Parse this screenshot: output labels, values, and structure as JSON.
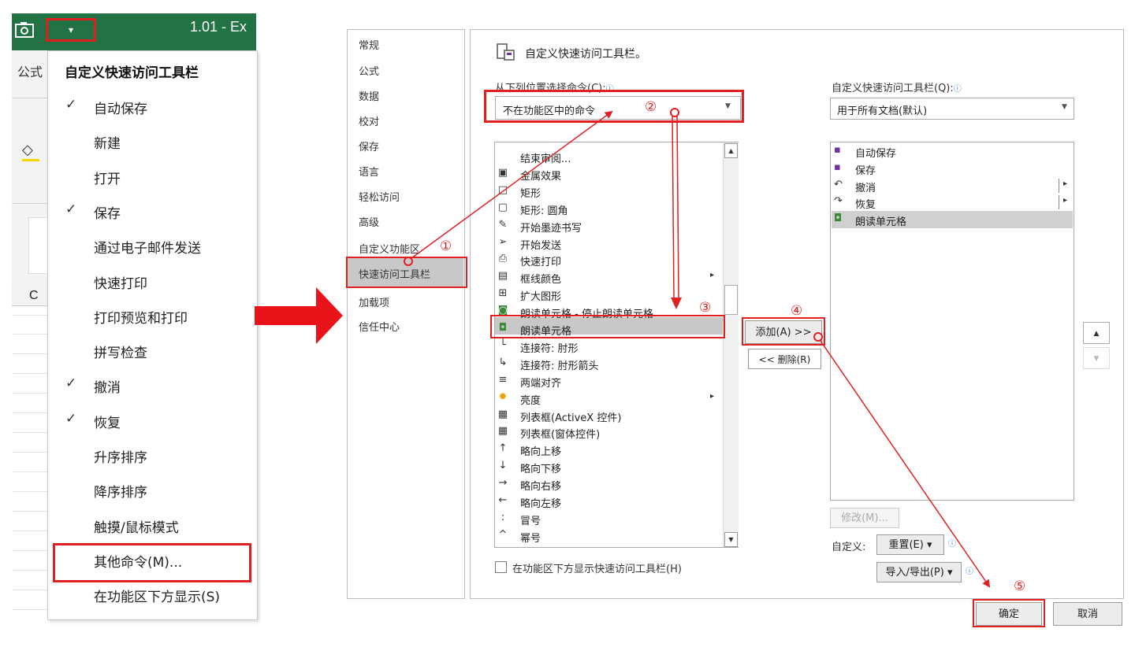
{
  "excel": {
    "file_title": "1.01  -  Ex",
    "qat_dropdown_glyph": "▾",
    "ribbon_tab": "公式",
    "column_header": "C"
  },
  "qat_menu": {
    "title": "自定义快速访问工具栏",
    "check_glyph": "✓",
    "items": [
      {
        "label": "自动保存",
        "checked": true
      },
      {
        "label": "新建",
        "checked": false
      },
      {
        "label": "打开",
        "checked": false
      },
      {
        "label": "保存",
        "checked": true
      },
      {
        "label": "通过电子邮件发送",
        "checked": false
      },
      {
        "label": "快速打印",
        "checked": false
      },
      {
        "label": "打印预览和打印",
        "checked": false
      },
      {
        "label": "拼写检查",
        "checked": false
      },
      {
        "label": "撤消",
        "checked": true
      },
      {
        "label": "恢复",
        "checked": true
      },
      {
        "label": "升序排序",
        "checked": false
      },
      {
        "label": "降序排序",
        "checked": false
      },
      {
        "label": "触摸/鼠标模式",
        "checked": false
      },
      {
        "label": "其他命令(M)...",
        "checked": false
      },
      {
        "label": "在功能区下方显示(S)",
        "checked": false
      }
    ]
  },
  "options_dialog": {
    "nav": [
      "常规",
      "公式",
      "数据",
      "校对",
      "保存",
      "语言",
      "轻松访问",
      "高级",
      "自定义功能区",
      "快速访问工具栏",
      "加载项",
      "信任中心"
    ],
    "nav_selected": "快速访问工具栏",
    "header_title": "自定义快速访问工具栏。",
    "choose_label": "从下列位置选择命令(C):",
    "choose_value": "不在功能区中的命令",
    "toolbar_label": "自定义快速访问工具栏(Q):",
    "toolbar_value": "用于所有文档(默认)",
    "info_glyph": "ⓘ",
    "commands": [
      {
        "label": "结束审阅...",
        "icon": "",
        "submenu": false
      },
      {
        "label": "金属效果",
        "icon": "cube-icon",
        "submenu": false
      },
      {
        "label": "矩形",
        "icon": "rectangle-icon",
        "submenu": false
      },
      {
        "label": "矩形: 圆角",
        "icon": "rounded-rectangle-icon",
        "submenu": false
      },
      {
        "label": "开始墨迹书写",
        "icon": "ink-pen-icon",
        "submenu": false
      },
      {
        "label": "开始发送",
        "icon": "send-icon",
        "submenu": false
      },
      {
        "label": "快速打印",
        "icon": "quick-print-icon",
        "submenu": false
      },
      {
        "label": "框线颜色",
        "icon": "border-color-icon",
        "submenu": true
      },
      {
        "label": "扩大图形",
        "icon": "enlarge-shape-icon",
        "submenu": false
      },
      {
        "label": "朗读单元格 - 停止朗读单元格",
        "icon": "stop-speak-icon",
        "submenu": false
      },
      {
        "label": "朗读单元格",
        "icon": "speak-cells-icon",
        "submenu": false
      },
      {
        "label": "连接符: 肘形",
        "icon": "elbow-connector-icon",
        "submenu": false
      },
      {
        "label": "连接符: 肘形箭头",
        "icon": "elbow-arrow-connector-icon",
        "submenu": false
      },
      {
        "label": "两端对齐",
        "icon": "justify-icon",
        "submenu": false
      },
      {
        "label": "亮度",
        "icon": "brightness-icon",
        "submenu": true
      },
      {
        "label": "列表框(ActiveX 控件)",
        "icon": "listbox-activex-icon",
        "submenu": false
      },
      {
        "label": "列表框(窗体控件)",
        "icon": "listbox-form-icon",
        "submenu": false
      },
      {
        "label": "略向上移",
        "icon": "nudge-up-icon",
        "submenu": false
      },
      {
        "label": "略向下移",
        "icon": "nudge-down-icon",
        "submenu": false
      },
      {
        "label": "略向右移",
        "icon": "nudge-right-icon",
        "submenu": false
      },
      {
        "label": "略向左移",
        "icon": "nudge-left-icon",
        "submenu": false
      },
      {
        "label": "冒号",
        "icon": "colon-icon",
        "submenu": false
      },
      {
        "label": "幂号",
        "icon": "power-icon",
        "submenu": false
      }
    ],
    "selected_command": "朗读单元格",
    "add_button": "添加(A) >>",
    "remove_button": "<< 删除(R)",
    "toolbar_items": [
      {
        "label": "自动保存",
        "icon": "autosave-icon",
        "submenu": false
      },
      {
        "label": "保存",
        "icon": "save-icon",
        "submenu": false
      },
      {
        "label": "撤消",
        "icon": "undo-icon",
        "submenu": true
      },
      {
        "label": "恢复",
        "icon": "redo-icon",
        "submenu": true
      },
      {
        "label": "朗读单元格",
        "icon": "speak-cells-icon",
        "submenu": false
      }
    ],
    "selected_toolbar_item": "朗读单元格",
    "move_up_glyph": "▲",
    "move_down_glyph": "▼",
    "modify_button": "修改(M)...",
    "customize_label": "自定义:",
    "reset_button": "重置(E) ▾",
    "import_export_button": "导入/导出(P) ▾",
    "show_below_ribbon_label": "在功能区下方显示快速访问工具栏(H)",
    "show_below_ribbon_checked": false,
    "ok_button": "确定",
    "cancel_button": "取消"
  },
  "annotations": {
    "step_labels": [
      "①",
      "②",
      "③",
      "④",
      "⑤"
    ],
    "color": "#e02020"
  }
}
